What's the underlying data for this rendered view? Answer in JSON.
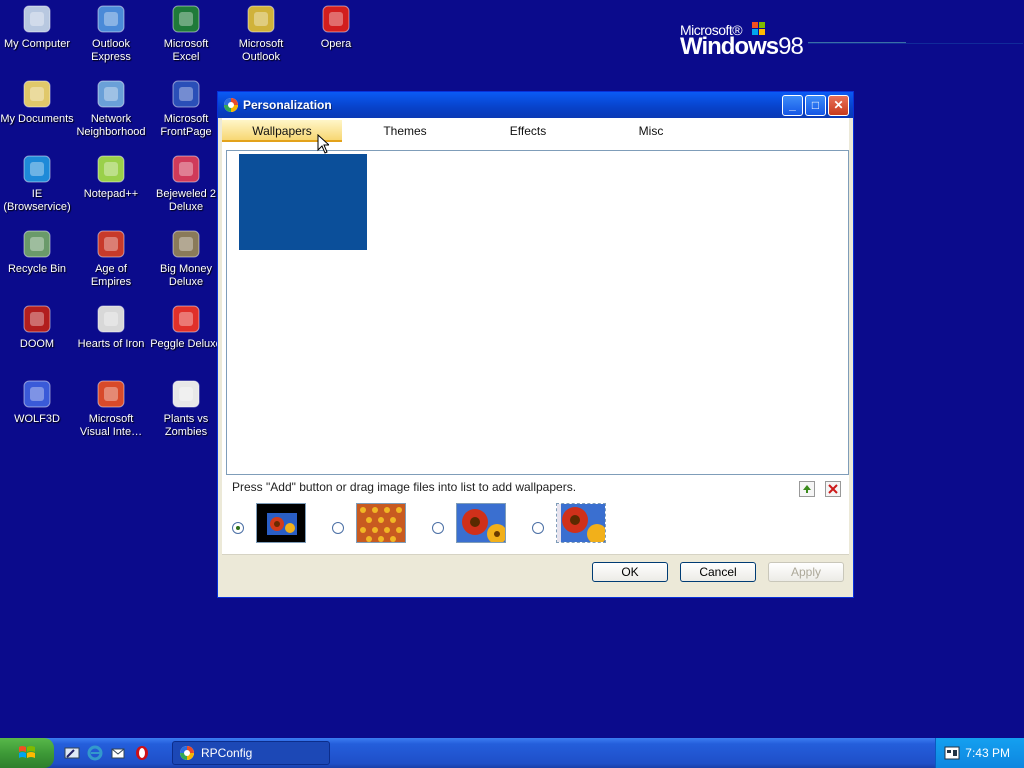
{
  "desktop": {
    "icons": [
      {
        "label": "My Computer",
        "icon": "computer-icon"
      },
      {
        "label": "Outlook\nExpress",
        "icon": "outlook-express-icon"
      },
      {
        "label": "Microsoft\nExcel",
        "icon": "excel-icon"
      },
      {
        "label": "Microsoft\nOutlook",
        "icon": "outlook-icon"
      },
      {
        "label": "Opera",
        "icon": "opera-icon"
      },
      {
        "label": "My Documents",
        "icon": "folder-icon"
      },
      {
        "label": "Network\nNeighborhood",
        "icon": "network-icon"
      },
      {
        "label": "Microsoft\nFrontPage",
        "icon": "frontpage-icon"
      },
      {
        "label": "IE\n(Browservice)",
        "icon": "ie-icon"
      },
      {
        "label": "Notepad++",
        "icon": "notepad-icon"
      },
      {
        "label": "Bejeweled 2\nDeluxe",
        "icon": "bejeweled-icon"
      },
      {
        "label": "Recycle Bin",
        "icon": "recycle-bin-icon"
      },
      {
        "label": "Age of\nEmpires",
        "icon": "age-of-empires-icon"
      },
      {
        "label": "Big Money\nDeluxe",
        "icon": "money-bag-icon"
      },
      {
        "label": "DOOM",
        "icon": "doom-icon"
      },
      {
        "label": "Hearts of Iron",
        "icon": "hearts-of-iron-icon"
      },
      {
        "label": "Peggle Deluxe",
        "icon": "peggle-icon"
      },
      {
        "label": "WOLF3D",
        "icon": "wolf3d-icon"
      },
      {
        "label": "Microsoft\nVisual Inte…",
        "icon": "visual-interdev-icon"
      },
      {
        "label": "Plants vs\nZombies",
        "icon": "plants-vs-zombies-icon"
      }
    ]
  },
  "logo": {
    "microsoft": "Microsoft®",
    "windows": "Windows",
    "version": "98"
  },
  "window": {
    "title": "Personalization",
    "tabs": [
      {
        "label": "Wallpapers",
        "active": true
      },
      {
        "label": "Themes",
        "active": false
      },
      {
        "label": "Effects",
        "active": false
      },
      {
        "label": "Misc",
        "active": false
      }
    ],
    "hint": "Press \"Add\" button or drag image files into list to add wallpapers.",
    "buttons": {
      "ok": "OK",
      "cancel": "Cancel",
      "apply": "Apply"
    }
  },
  "taskbar": {
    "task_label": "RPConfig",
    "clock": "7:43 PM"
  },
  "colors": {
    "desktop": "#0b0b8c",
    "selected_wallpaper": "#0b4f9a",
    "titlebar": "#0842c9"
  }
}
